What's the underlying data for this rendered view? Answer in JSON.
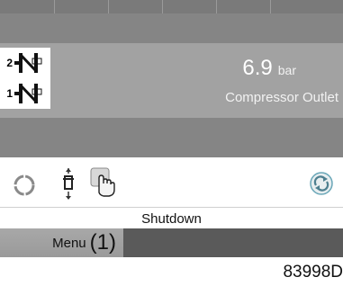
{
  "display": {
    "indicators": [
      {
        "number": "2",
        "icon": "blocked-pressure-sensor-icon"
      },
      {
        "number": "1",
        "icon": "blocked-pressure-sensor-icon"
      }
    ],
    "value": "6.9",
    "unit": "bar",
    "label": "Compressor Outlet"
  },
  "icon_row": {
    "icons": [
      "open-circle-icon",
      "valve-icon",
      "hand-icon",
      "sync-icon"
    ]
  },
  "status": {
    "text": "Shutdown"
  },
  "menu": {
    "label": "Menu",
    "number": "(1)"
  },
  "figure_id": "83998D",
  "colors": {
    "panel_dark": "#858585",
    "panel_value": "#a2a2a2",
    "menu_bar": "#5a5a5a",
    "menu_button": "#a0a0a0",
    "sync_accent": "#6aa7b8"
  }
}
